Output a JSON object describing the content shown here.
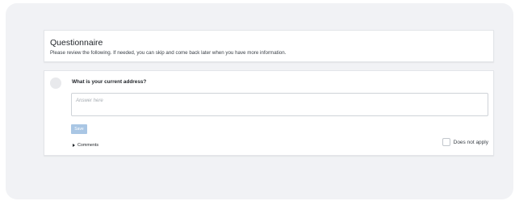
{
  "questionnaire": {
    "title": "Questionnaire",
    "subtitle": "Please review the following. If needed, you can skip and come back later when you have more information."
  },
  "question": {
    "text": "What is your current address?",
    "answer_placeholder": "Answer here",
    "answer_value": "",
    "save_label": "Save",
    "comments_label": "Comments",
    "does_not_apply_label": "Does not apply",
    "does_not_apply_checked": false
  },
  "colors": {
    "page_background": "#f1f2f5",
    "card_background": "#ffffff",
    "save_button": "#a9c6e4"
  },
  "icons": {
    "avatar": "avatar-circle",
    "comments_toggle": "caret-right-icon",
    "resize": "resize-grip-icon"
  }
}
